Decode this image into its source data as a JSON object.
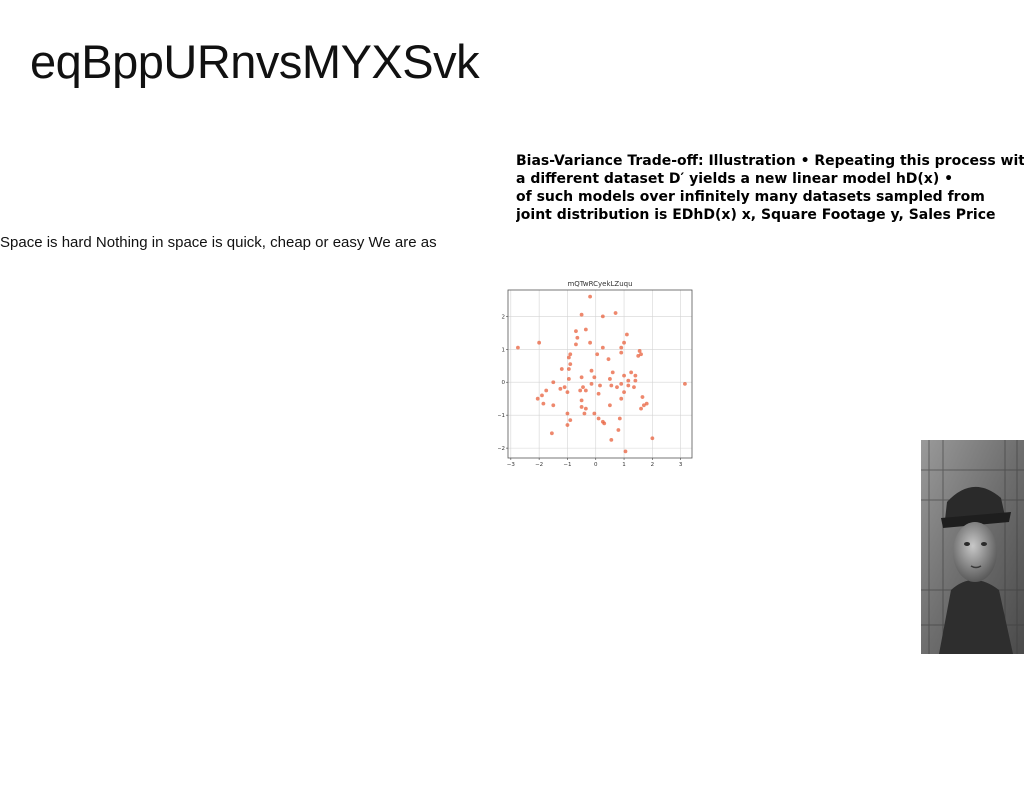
{
  "page": {
    "title": "eqBppURnvsMYXSvk",
    "heading_lines": [
      "Bias-Variance Trade-off: Illustration • Repeating this process with",
      "a different dataset D′ yields a new linear model hD(x) •",
      "of such models over infinitely many datasets sampled from",
      "joint distribution is EDhD(x) x, Square Footage y, Sales Price"
    ],
    "body_text": "Space is hard Nothing in space is quick, cheap or easy We are as"
  },
  "photo": {
    "description_icon": "grayscale-portrait-photo"
  },
  "chart_data": {
    "type": "scatter",
    "title": "mQTwRCyekLZuqu",
    "xlabel": "",
    "ylabel": "",
    "xlim": [
      -3.1,
      3.4
    ],
    "ylim": [
      -2.3,
      2.8
    ],
    "x_ticks": [
      -3,
      -2,
      -1,
      0,
      1,
      2,
      3
    ],
    "y_ticks": [
      -2,
      -1,
      0,
      1,
      2
    ],
    "x_tick_labels": [
      "−3",
      "−2",
      "−1",
      "0",
      "1",
      "2",
      "3"
    ],
    "y_tick_labels": [
      "−2",
      "−1",
      "0",
      "1",
      "2"
    ],
    "grid": true,
    "point_color": "#e8603c",
    "points": [
      [
        -0.2,
        2.6
      ],
      [
        0.7,
        2.1
      ],
      [
        -0.5,
        2.05
      ],
      [
        0.25,
        2.0
      ],
      [
        -0.35,
        1.6
      ],
      [
        -0.7,
        1.55
      ],
      [
        1.1,
        1.45
      ],
      [
        -0.65,
        1.35
      ],
      [
        -2.0,
        1.2
      ],
      [
        -0.2,
        1.2
      ],
      [
        -0.7,
        1.15
      ],
      [
        1.0,
        1.2
      ],
      [
        -2.75,
        1.05
      ],
      [
        0.9,
        1.05
      ],
      [
        0.25,
        1.05
      ],
      [
        -0.9,
        0.85
      ],
      [
        1.55,
        0.95
      ],
      [
        0.9,
        0.9
      ],
      [
        0.05,
        0.85
      ],
      [
        1.6,
        0.85
      ],
      [
        -0.95,
        0.75
      ],
      [
        1.5,
        0.8
      ],
      [
        0.45,
        0.7
      ],
      [
        -0.9,
        0.55
      ],
      [
        -1.2,
        0.4
      ],
      [
        -0.95,
        0.4
      ],
      [
        -0.15,
        0.35
      ],
      [
        0.6,
        0.3
      ],
      [
        1.25,
        0.3
      ],
      [
        1.0,
        0.2
      ],
      [
        -0.05,
        0.15
      ],
      [
        -0.5,
        0.15
      ],
      [
        1.4,
        0.2
      ],
      [
        -0.95,
        0.1
      ],
      [
        0.5,
        0.1
      ],
      [
        1.15,
        0.05
      ],
      [
        -1.5,
        0.0
      ],
      [
        0.9,
        -0.05
      ],
      [
        1.4,
        0.05
      ],
      [
        1.15,
        -0.1
      ],
      [
        -0.15,
        -0.05
      ],
      [
        0.55,
        -0.1
      ],
      [
        0.15,
        -0.1
      ],
      [
        3.15,
        -0.05
      ],
      [
        -1.1,
        -0.15
      ],
      [
        -0.45,
        -0.15
      ],
      [
        0.75,
        -0.15
      ],
      [
        1.35,
        -0.15
      ],
      [
        -1.25,
        -0.2
      ],
      [
        -1.75,
        -0.25
      ],
      [
        -0.55,
        -0.25
      ],
      [
        -0.35,
        -0.25
      ],
      [
        1.0,
        -0.3
      ],
      [
        -1.0,
        -0.3
      ],
      [
        0.1,
        -0.35
      ],
      [
        -1.9,
        -0.4
      ],
      [
        1.65,
        -0.45
      ],
      [
        -2.05,
        -0.5
      ],
      [
        0.9,
        -0.5
      ],
      [
        -0.5,
        -0.55
      ],
      [
        -1.85,
        -0.65
      ],
      [
        1.8,
        -0.65
      ],
      [
        1.7,
        -0.7
      ],
      [
        -1.5,
        -0.7
      ],
      [
        0.5,
        -0.7
      ],
      [
        -0.5,
        -0.75
      ],
      [
        -0.35,
        -0.8
      ],
      [
        1.6,
        -0.8
      ],
      [
        -1.0,
        -0.95
      ],
      [
        -0.4,
        -0.95
      ],
      [
        -0.05,
        -0.95
      ],
      [
        0.85,
        -1.1
      ],
      [
        -0.9,
        -1.15
      ],
      [
        0.1,
        -1.1
      ],
      [
        0.25,
        -1.2
      ],
      [
        0.3,
        -1.25
      ],
      [
        -1.0,
        -1.3
      ],
      [
        0.8,
        -1.45
      ],
      [
        -1.55,
        -1.55
      ],
      [
        2.0,
        -1.7
      ],
      [
        0.55,
        -1.75
      ],
      [
        1.05,
        -2.1
      ]
    ]
  }
}
